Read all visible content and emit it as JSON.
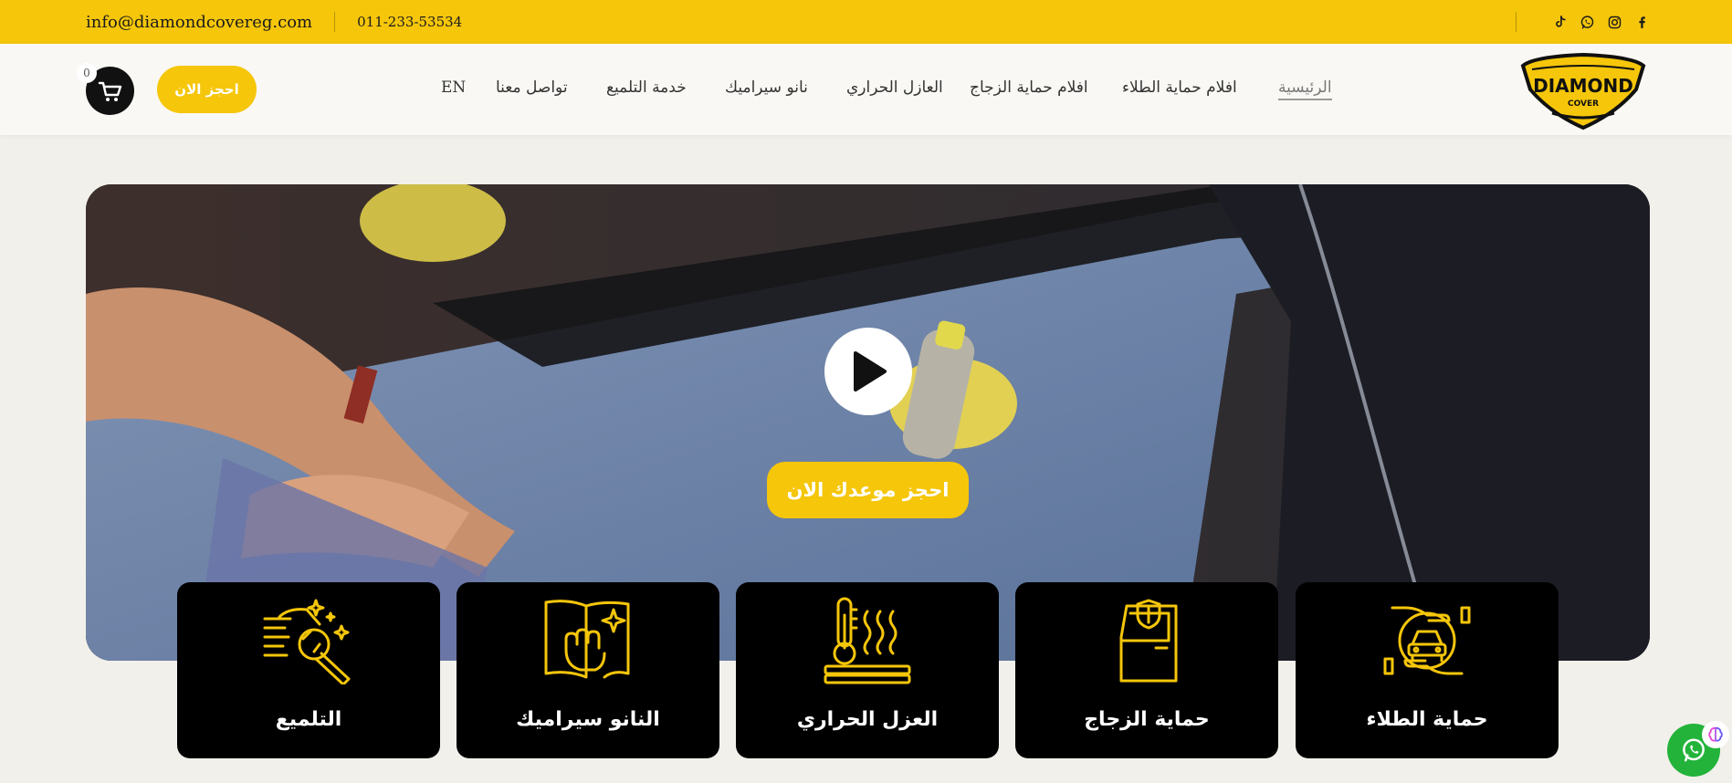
{
  "topbar": {
    "email": "info@diamondcovereg.com",
    "phone": "011-233-53534",
    "social_icons": [
      "tiktok-icon",
      "whatsapp-icon",
      "instagram-icon",
      "facebook-icon"
    ],
    "background": "#f5c60a"
  },
  "header": {
    "cart_count": "0",
    "book_label": "احجز الان",
    "logo_text": "DIAMOND",
    "logo_subtext": "COVER",
    "nav": [
      {
        "label": "الرئيسية",
        "active": true
      },
      {
        "label": "افلام حماية الطلاء",
        "active": false
      },
      {
        "label": "افلام حماية الزجاج",
        "active": false
      },
      {
        "label": "العازل الحراري",
        "active": false
      },
      {
        "label": "نانو سيراميك",
        "active": false
      },
      {
        "label": "خدمة التلميع",
        "active": false
      },
      {
        "label": "تواصل معنا",
        "active": false
      },
      {
        "label": "EN",
        "active": false
      }
    ]
  },
  "hero": {
    "cta_label": "احجز موعدك الان",
    "play_icon": "play-icon"
  },
  "services": [
    {
      "title": "حماية الطلاء",
      "icon": "car-protection-icon"
    },
    {
      "title": "حماية الزجاج",
      "icon": "glass-shield-icon"
    },
    {
      "title": "العزل الحراري",
      "icon": "thermometer-heat-icon"
    },
    {
      "title": "النانو سيراميك",
      "icon": "hand-cloth-sparkle-icon"
    },
    {
      "title": "التلميع",
      "icon": "car-polish-icon"
    }
  ],
  "colors": {
    "accent": "#f5c60a",
    "card_bg": "#000000",
    "whatsapp": "#23b33a"
  }
}
